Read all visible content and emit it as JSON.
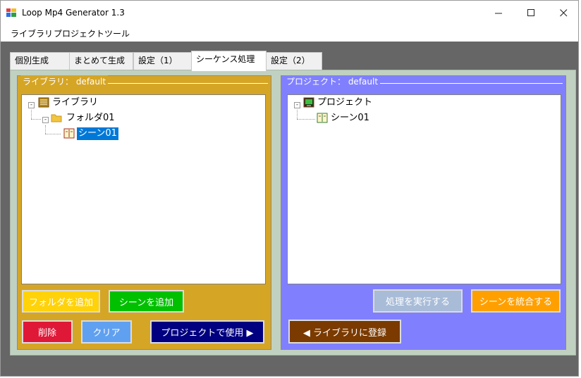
{
  "window": {
    "title": "Loop Mp4 Generator  1.3"
  },
  "menu": {
    "items": [
      "ライブラリ",
      "プロジェクト",
      "ツール"
    ]
  },
  "tabs": [
    "個別生成",
    "まとめて生成",
    "設定（1）",
    "シーケンス処理",
    "設定（2）"
  ],
  "library": {
    "legend": "ライブラリ： default",
    "tree": {
      "root": "ライブラリ",
      "folder": "フォルダ01",
      "scene": "シーン01"
    },
    "buttons": {
      "add_folder": "フォルダを追加",
      "add_scene": "シーンを追加",
      "delete": "削除",
      "clear": "クリア",
      "use_in_project": "プロジェクトで使用 ▶"
    }
  },
  "project": {
    "legend": "プロジェクト： default",
    "tree": {
      "root": "プロジェクト",
      "scene": "シーン01"
    },
    "buttons": {
      "execute": "処理を実行する",
      "merge_scenes": "シーンを統合する",
      "register_library": "◀ ライブラリに登録"
    }
  },
  "colors": {
    "library_panel": "#d5a526",
    "project_panel": "#8080ff",
    "tab_page": "#c1d1c1",
    "selection": "#0078d7"
  }
}
